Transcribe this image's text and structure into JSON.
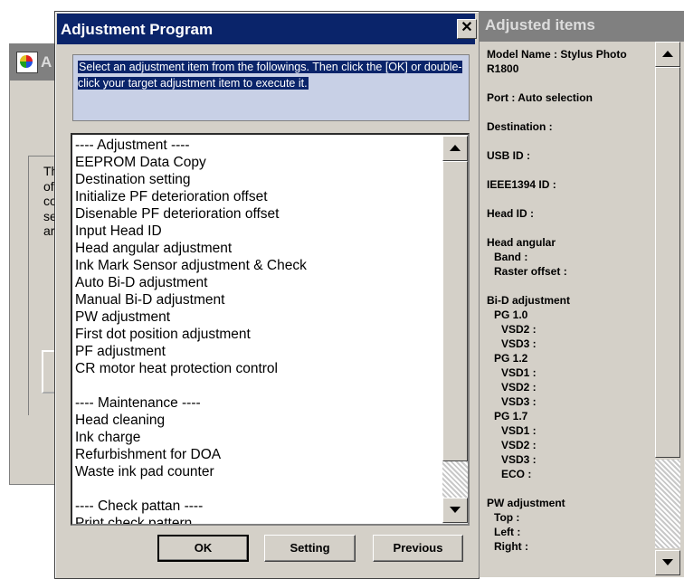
{
  "background_window": {
    "title_fragment": "A",
    "text_lines": [
      "Th",
      "of",
      "co",
      "se",
      "ar"
    ]
  },
  "dialog": {
    "title": "Adjustment Program",
    "close_symbol": "✕",
    "instruction": "Select an adjustment item from the followings. Then click the [OK] or double-click your target adjustment item to execute it.",
    "items": [
      "---- Adjustment ----",
      "EEPROM Data Copy",
      "Destination setting",
      "Initialize PF deterioration offset",
      "Disenable PF deterioration offset",
      "Input Head ID",
      "Head angular adjustment",
      "Ink Mark Sensor adjustment & Check",
      "Auto Bi-D adjustment",
      "Manual Bi-D adjustment",
      "PW adjustment",
      "First dot position adjustment",
      "PF adjustment",
      "CR motor heat protection control",
      "",
      "---- Maintenance ----",
      "Head cleaning",
      "Ink charge",
      "Refurbishment for DOA",
      "Waste ink pad counter",
      "",
      "---- Check pattan ----",
      "Print check pattern"
    ],
    "buttons": {
      "ok": "OK",
      "setting": "Setting",
      "previous": "Previous"
    }
  },
  "adjusted_items": {
    "title": "Adjusted items",
    "lines": [
      {
        "text": "Model Name : Stylus Photo",
        "indent": 0
      },
      {
        "text": "R1800",
        "indent": 0
      },
      {
        "text": "",
        "indent": 0
      },
      {
        "text": "Port : Auto selection",
        "indent": 0
      },
      {
        "text": "",
        "indent": 0
      },
      {
        "text": "Destination :",
        "indent": 0
      },
      {
        "text": "",
        "indent": 0
      },
      {
        "text": "USB ID :",
        "indent": 0
      },
      {
        "text": "",
        "indent": 0
      },
      {
        "text": "IEEE1394 ID :",
        "indent": 0
      },
      {
        "text": "",
        "indent": 0
      },
      {
        "text": "Head ID :",
        "indent": 0
      },
      {
        "text": "",
        "indent": 0
      },
      {
        "text": "Head angular",
        "indent": 0
      },
      {
        "text": "Band :",
        "indent": 1
      },
      {
        "text": "Raster offset :",
        "indent": 1
      },
      {
        "text": "",
        "indent": 0
      },
      {
        "text": "Bi-D adjustment",
        "indent": 0
      },
      {
        "text": "PG 1.0",
        "indent": 1
      },
      {
        "text": "VSD2 :",
        "indent": 2
      },
      {
        "text": "VSD3 :",
        "indent": 2
      },
      {
        "text": "PG 1.2",
        "indent": 1
      },
      {
        "text": "VSD1 :",
        "indent": 2
      },
      {
        "text": "VSD2 :",
        "indent": 2
      },
      {
        "text": "VSD3 :",
        "indent": 2
      },
      {
        "text": "PG 1.7",
        "indent": 1
      },
      {
        "text": "VSD1 :",
        "indent": 2
      },
      {
        "text": "VSD2 :",
        "indent": 2
      },
      {
        "text": "VSD3 :",
        "indent": 2
      },
      {
        "text": "ECO :",
        "indent": 2
      },
      {
        "text": "",
        "indent": 0
      },
      {
        "text": "PW adjustment",
        "indent": 0
      },
      {
        "text": "Top :",
        "indent": 1
      },
      {
        "text": "Left :",
        "indent": 1
      },
      {
        "text": "Right :",
        "indent": 1
      }
    ]
  },
  "icons": {
    "app": "epson-app-icon",
    "close": "close-icon",
    "scroll_up": "arrow-up-icon",
    "scroll_down": "arrow-down-icon"
  },
  "colors": {
    "active_title": "#0a246a",
    "inactive_title": "#808080",
    "face": "#d4d0c8",
    "selection": "#0a246a"
  }
}
